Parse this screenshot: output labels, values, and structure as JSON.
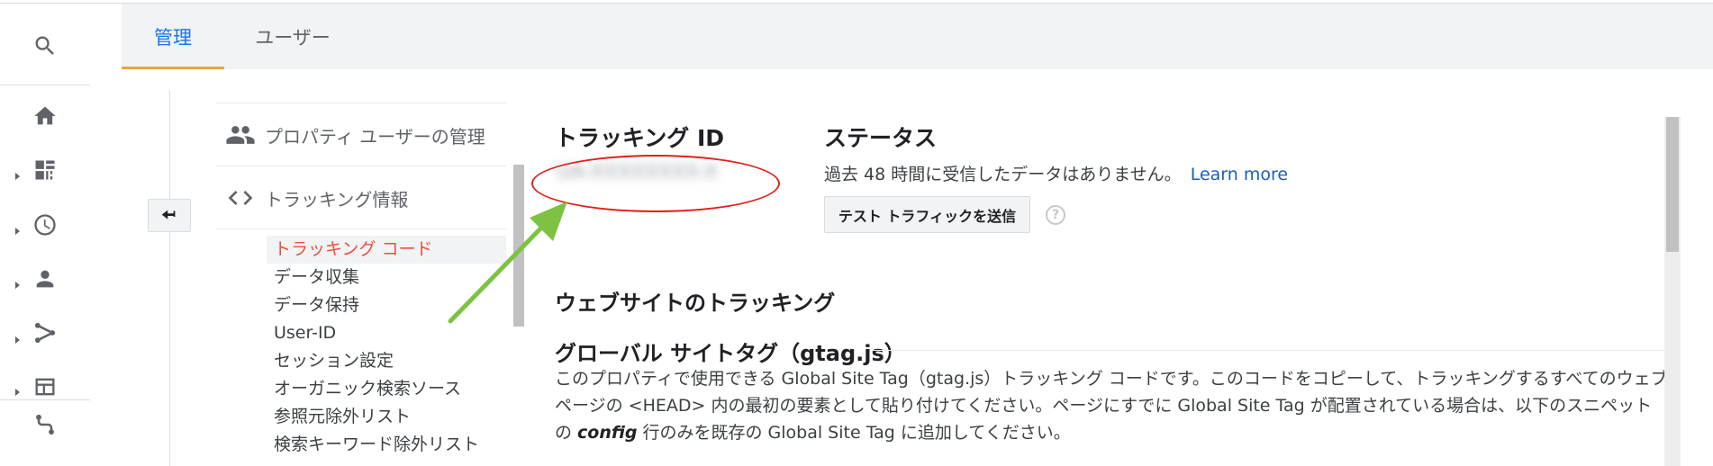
{
  "tabs": [
    {
      "label": "管理",
      "active": true
    },
    {
      "label": "ユーザー",
      "active": false
    }
  ],
  "rail": {
    "icons": [
      "search-icon",
      "home-icon",
      "dashboard-icon",
      "clock-icon",
      "person-icon",
      "fork-icon",
      "table-icon",
      "route-icon"
    ]
  },
  "nav": {
    "users_label": "プロパティ ユーザーの管理",
    "tracking_label": "トラッキング情報",
    "sub_items": [
      "トラッキング コード",
      "データ収集",
      "データ保持",
      "User-ID",
      "セッション設定",
      "オーガニック検索ソース",
      "参照元除外リスト",
      "検索キーワード除外リスト"
    ],
    "active_index": 0
  },
  "tracking": {
    "heading": "トラッキング ID",
    "id_value": "UA-XXXXXXXX-X"
  },
  "status": {
    "heading": "ステータス",
    "text": "過去 48 時間に受信したデータはありません。",
    "learn_more": "Learn more",
    "test_button": "テスト トラフィックを送信",
    "help": "?"
  },
  "website": {
    "heading": "ウェブサイトのトラッキング",
    "gtag_heading": "グローバル サイトタグ（gtag.js）",
    "desc_1": "このプロパティで使用できる Global Site Tag（gtag.js）トラッキング コードです。このコードをコピーして、トラッキングするすべてのウェブページの <HEAD> 内の最初の要素として貼り付けてください。ページにすでに Global Site Tag が配置されている場合は、以下のスニペットの ",
    "desc_em": "config",
    "desc_2": " 行のみを既存の Global Site Tag に追加してください。"
  },
  "colors": {
    "accent_blue": "#1a73e8",
    "active_nav": "#e8503a",
    "tab_underline": "#e8a93a",
    "annotation_red": "#e0201a",
    "annotation_green": "#7dc242"
  }
}
